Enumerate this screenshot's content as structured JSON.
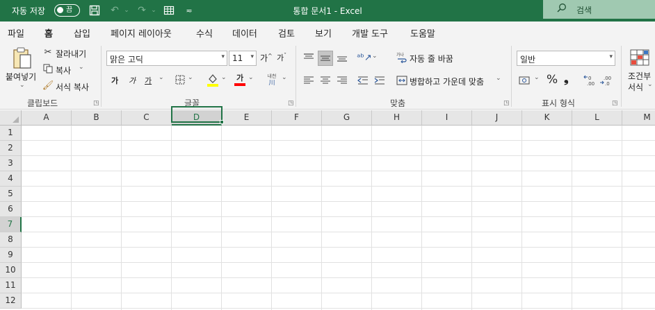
{
  "titlebar": {
    "autosave_label": "자동 저장",
    "autosave_state": "끔",
    "document_title": "통합 문서1  -  Excel",
    "search_placeholder": "검색"
  },
  "menu": {
    "tabs": [
      "파일",
      "홈",
      "삽입",
      "페이지 레이아웃",
      "수식",
      "데이터",
      "검토",
      "보기",
      "개발 도구",
      "도움말"
    ],
    "active": "홈"
  },
  "ribbon": {
    "clipboard": {
      "paste_label": "붙여넣기",
      "cut_label": "잘라내기",
      "copy_label": "복사",
      "format_painter_label": "서식 복사",
      "group_label": "클립보드"
    },
    "font": {
      "font_name": "맑은 고딕",
      "font_size": "11",
      "bold": "가",
      "italic": "가",
      "underline": "가",
      "font_color_glyph": "가",
      "phonetic_glyph": "내천",
      "group_label": "글꼴"
    },
    "alignment": {
      "wrap_text_label": "자동 줄 바꿈",
      "merge_label": "병합하고 가운데 맞춤",
      "group_label": "맞춤"
    },
    "number": {
      "format": "일반",
      "percent": "%",
      "comma": "❟",
      "group_label": "표시 형식"
    },
    "styles": {
      "conditional_label_1": "조건부",
      "conditional_label_2": "서식"
    }
  },
  "grid": {
    "columns": [
      "A",
      "B",
      "C",
      "D",
      "E",
      "F",
      "G",
      "H",
      "I",
      "J",
      "K",
      "L",
      "M"
    ],
    "rows": [
      "1",
      "2",
      "3",
      "4",
      "5",
      "6",
      "7",
      "8",
      "9",
      "10",
      "11",
      "12"
    ],
    "selected_column": "D",
    "selected_row": "7"
  },
  "colors": {
    "accent": "#217346",
    "highlight_yellow": "#ffff00",
    "font_red": "#ff0000"
  }
}
